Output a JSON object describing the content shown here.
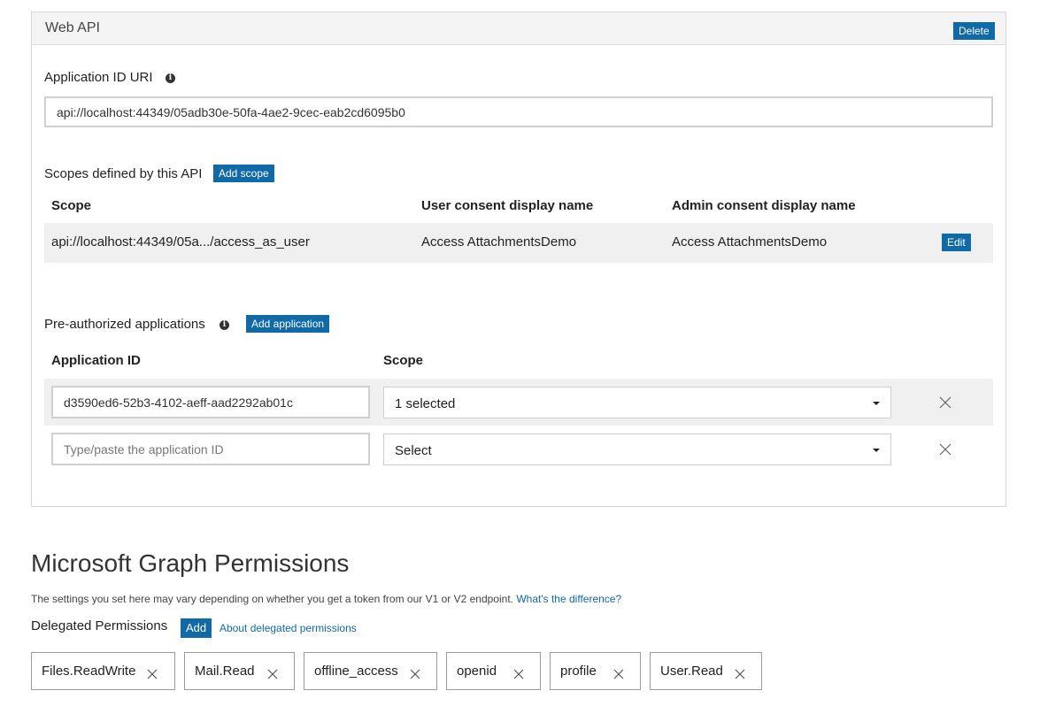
{
  "web_api": {
    "title": "Web API",
    "delete_label": "Delete",
    "app_id_uri_label": "Application ID URI",
    "app_id_uri_value": "api://localhost:44349/05adb30e-50fa-4ae2-9cec-eab2cd6095b0",
    "scopes_label": "Scopes defined by this API",
    "add_scope_label": "Add scope",
    "scopes_table": {
      "headers": [
        "Scope",
        "User consent display name",
        "Admin consent display name"
      ],
      "rows": [
        {
          "scope": "api://localhost:44349/05a.../access_as_user",
          "user_consent": "Access AttachmentsDemo",
          "admin_consent": "Access AttachmentsDemo",
          "edit_label": "Edit"
        }
      ]
    },
    "preauth_label": "Pre-authorized applications",
    "add_application_label": "Add application",
    "preauth_table": {
      "headers": [
        "Application ID",
        "Scope"
      ],
      "rows": [
        {
          "app_id": "d3590ed6-52b3-4102-aeff-aad2292ab01c",
          "scope_value": "1 selected"
        },
        {
          "app_id": "",
          "app_id_placeholder": "Type/paste the application ID",
          "scope_value": "Select"
        }
      ]
    }
  },
  "graph": {
    "title": "Microsoft Graph Permissions",
    "note": "The settings you set here may vary depending on whether you get a token from our V1 or V2 endpoint.",
    "note_link": "What's the difference?",
    "delegated_label": "Delegated Permissions",
    "add_label": "Add",
    "about_link": "About delegated permissions",
    "permissions": [
      "Files.ReadWrite",
      "Mail.Read",
      "offline_access",
      "openid",
      "profile",
      "User.Read"
    ]
  },
  "icons": {
    "info": "info-icon",
    "remove": "close-icon",
    "dropdown": "chevron-down-icon"
  },
  "colors": {
    "accent": "#0f6aa7",
    "header_bg": "#f4f4f4",
    "row_bg": "#f0f0f0"
  }
}
